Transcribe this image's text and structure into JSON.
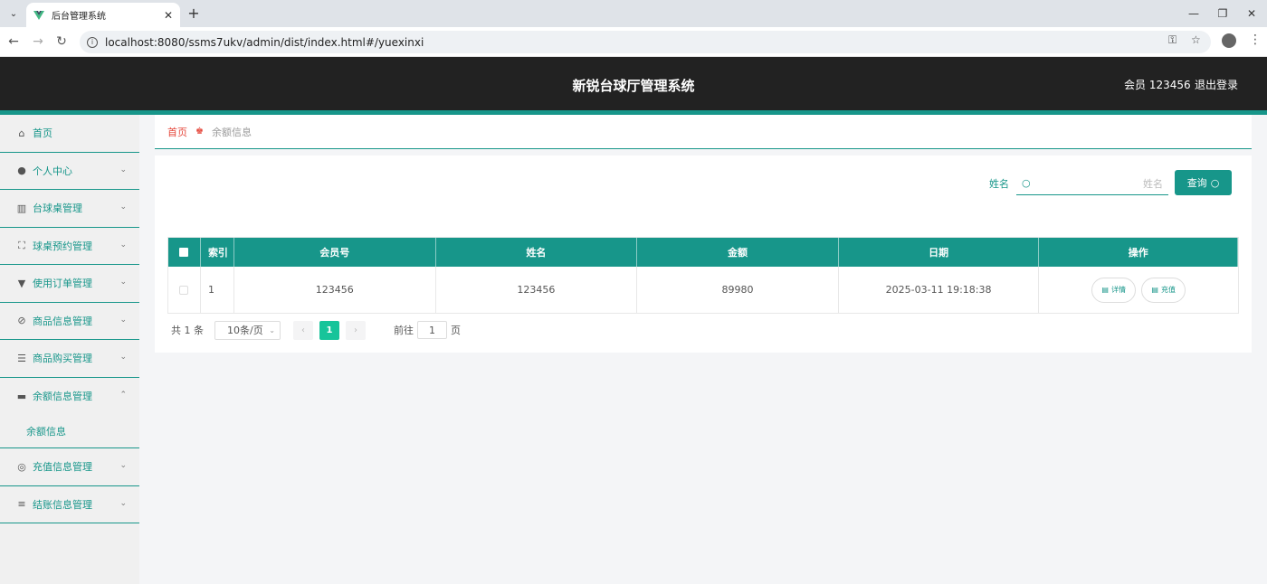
{
  "browser": {
    "tab_title": "后台管理系统",
    "url": "localhost:8080/ssms7ukv/admin/dist/index.html#/yuexinxi"
  },
  "header": {
    "title": "新锐台球厅管理系统",
    "user": "会员 123456",
    "logout": "退出登录"
  },
  "sidebar": {
    "items": [
      {
        "label": "首页",
        "icon": "home-icon"
      },
      {
        "label": "个人中心",
        "icon": "user-icon"
      },
      {
        "label": "台球桌管理",
        "icon": "table-icon"
      },
      {
        "label": "球桌预约管理",
        "icon": "fullscreen-icon"
      },
      {
        "label": "使用订单管理",
        "icon": "cup-icon"
      },
      {
        "label": "商品信息管理",
        "icon": "discount-icon"
      },
      {
        "label": "商品购买管理",
        "icon": "list-icon"
      },
      {
        "label": "余额信息管理",
        "icon": "ticket-icon"
      },
      {
        "label": "充值信息管理",
        "icon": "basketball-icon"
      },
      {
        "label": "结账信息管理",
        "icon": "sliders-icon"
      }
    ],
    "sub_item": "余额信息"
  },
  "breadcrumb": {
    "home": "首页",
    "current": "余额信息"
  },
  "search": {
    "label": "姓名",
    "placeholder": "姓名",
    "button": "查询"
  },
  "table": {
    "columns": [
      "索引",
      "会员号",
      "姓名",
      "金额",
      "日期",
      "操作"
    ],
    "rows": [
      {
        "index": "1",
        "member_no": "123456",
        "name": "123456",
        "amount": "89980",
        "date": "2025-03-11 19:18:38"
      }
    ],
    "actions": {
      "detail": "详情",
      "recharge": "充值"
    }
  },
  "pager": {
    "total": "共 1 条",
    "page_size": "10条/页",
    "current_page": "1",
    "goto_label": "前往",
    "goto_value": "1",
    "page_unit": "页"
  },
  "colors": {
    "accent": "#17968a",
    "header_bg": "#222222",
    "page_active": "#17c49a",
    "breadcrumb_home": "#e5473b"
  }
}
